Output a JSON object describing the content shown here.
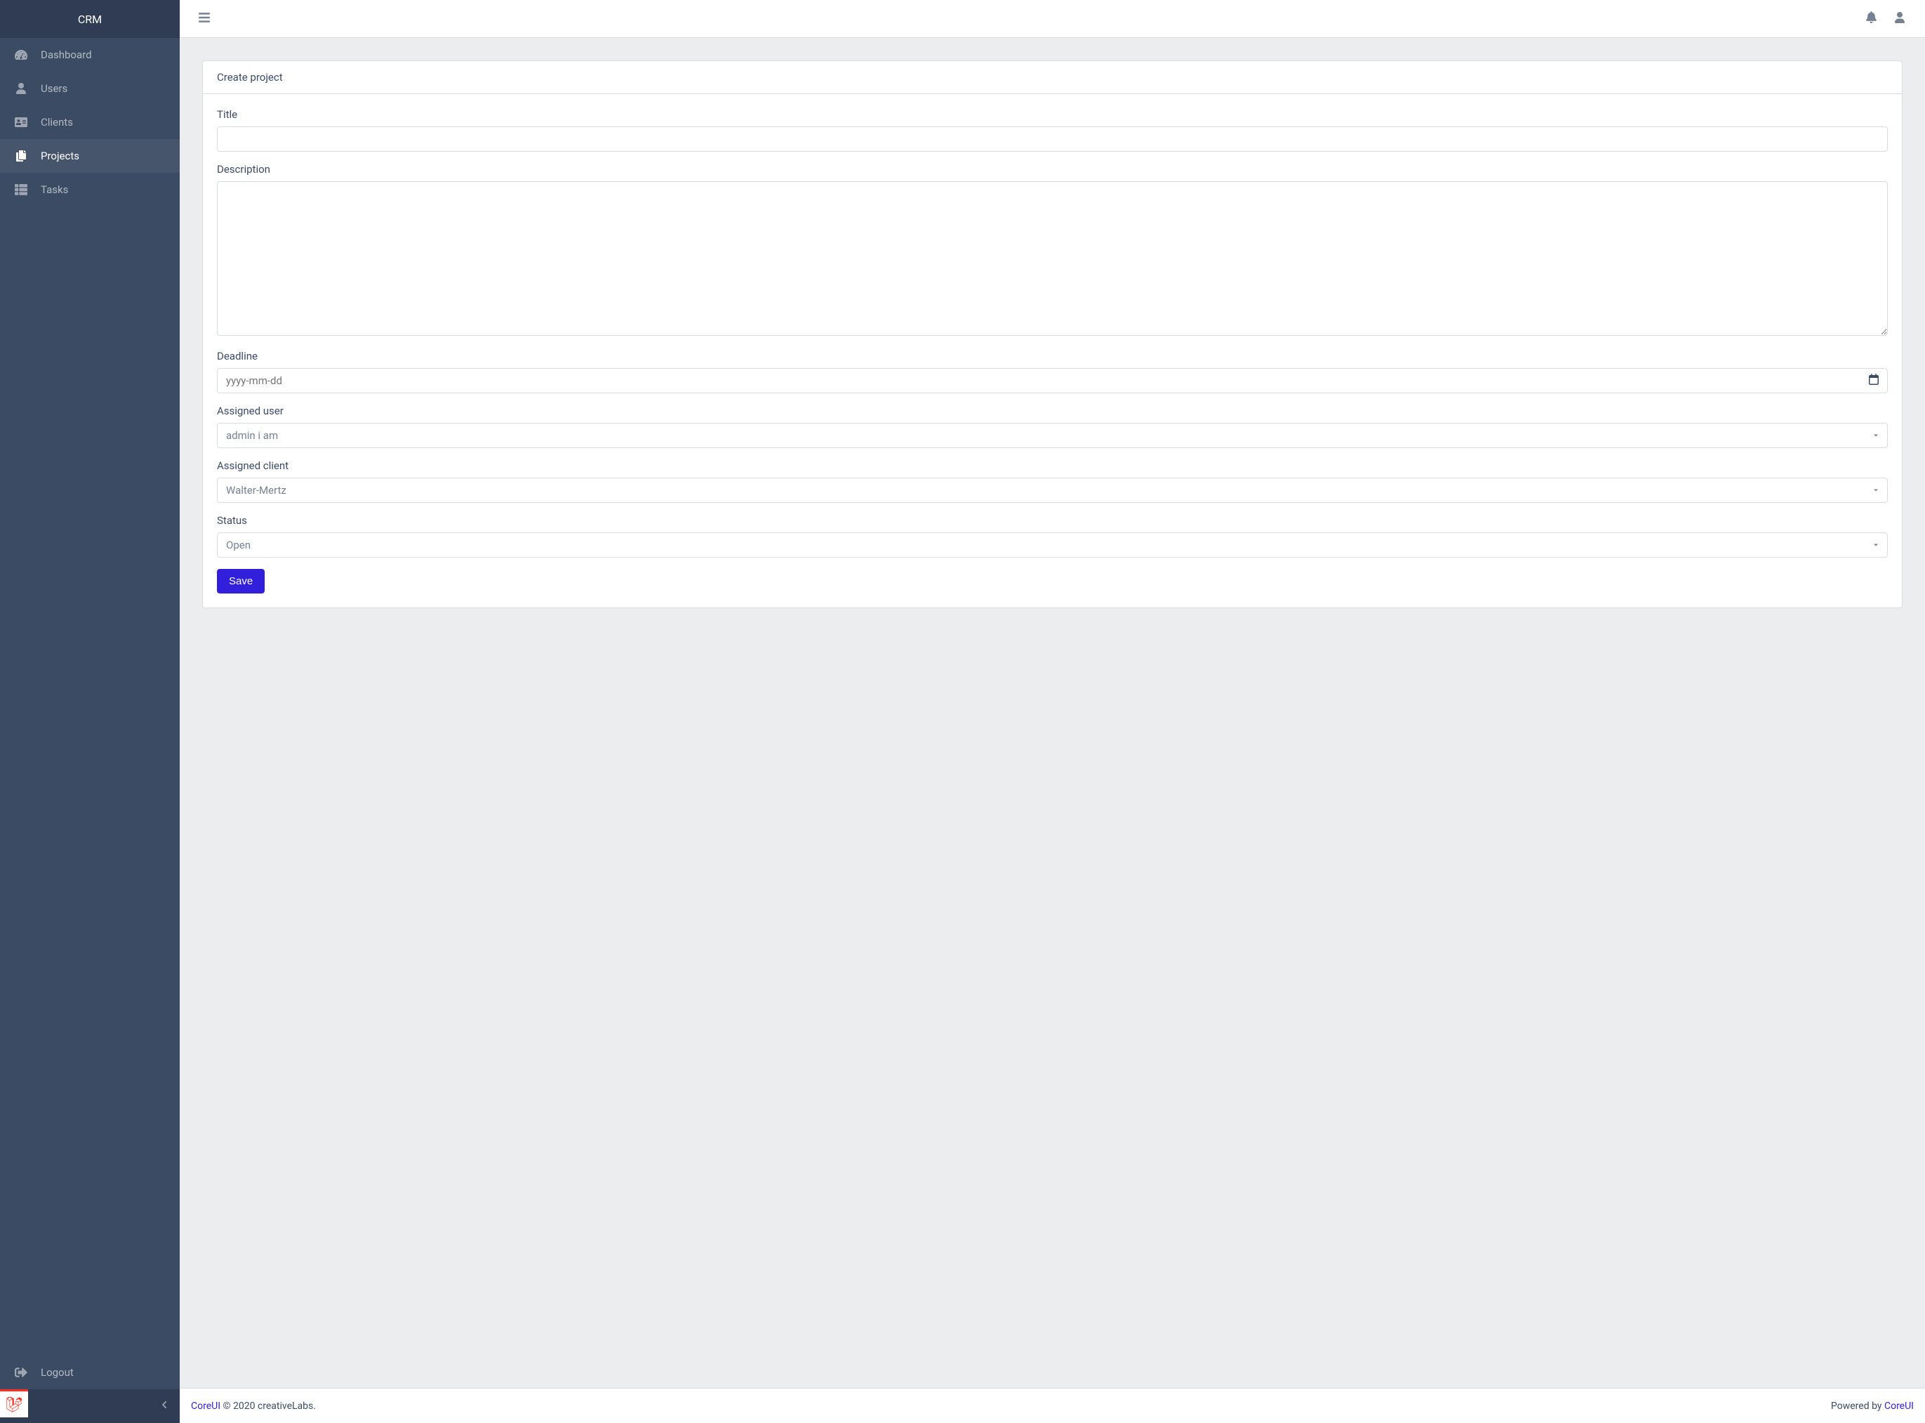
{
  "brand": "CRM",
  "sidebar": {
    "items": [
      {
        "label": "Dashboard"
      },
      {
        "label": "Users"
      },
      {
        "label": "Clients"
      },
      {
        "label": "Projects"
      },
      {
        "label": "Tasks"
      }
    ],
    "logout_label": "Logout"
  },
  "card": {
    "header": "Create project"
  },
  "form": {
    "title_label": "Title",
    "title_value": "",
    "description_label": "Description",
    "description_value": "",
    "deadline_label": "Deadline",
    "deadline_placeholder": "yyyy-mm-dd",
    "deadline_value": "",
    "assigned_user_label": "Assigned user",
    "assigned_user_value": "admin i am",
    "assigned_client_label": "Assigned client",
    "assigned_client_value": "Walter-Mertz",
    "status_label": "Status",
    "status_value": "Open",
    "save_label": "Save"
  },
  "footer": {
    "link1": "CoreUI",
    "copyright": " © 2020 creativeLabs.",
    "powered_prefix": "Powered by ",
    "link2": "CoreUI"
  }
}
